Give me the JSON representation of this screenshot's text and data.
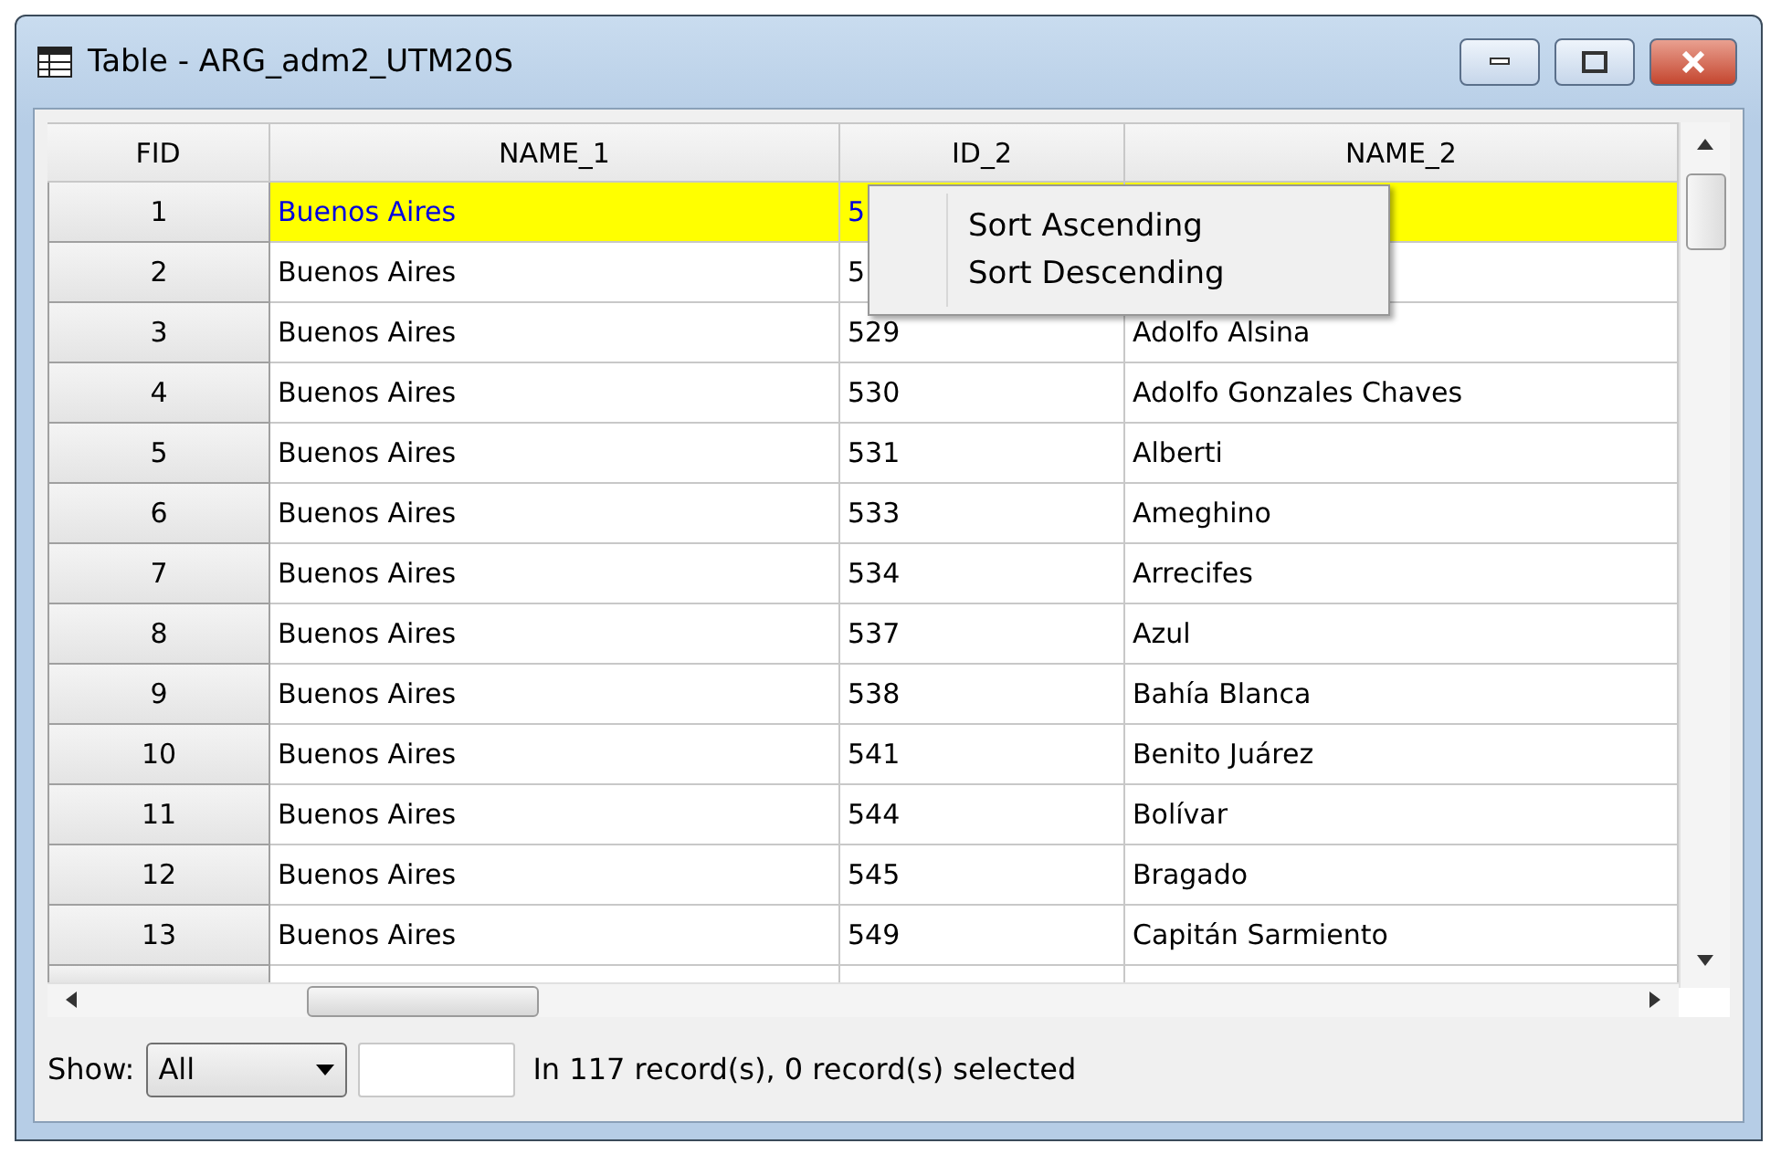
{
  "window": {
    "title": "Table - ARG_adm2_UTM20S"
  },
  "table": {
    "columns": [
      "FID",
      "NAME_1",
      "ID_2",
      "NAME_2"
    ],
    "rows": [
      {
        "fid": "1",
        "name_1": "Buenos Aires",
        "id_2": "5",
        "selected": true
      },
      {
        "fid": "2",
        "name_1": "Buenos Aires",
        "id_2": "5",
        "selected": false
      },
      {
        "fid": "3",
        "name_1": "Buenos Aires",
        "id_2": "529",
        "name_2": "Adolfo Alsina",
        "selected": false
      },
      {
        "fid": "4",
        "name_1": "Buenos Aires",
        "id_2": "530",
        "name_2": "Adolfo Gonzales Chaves",
        "selected": false
      },
      {
        "fid": "5",
        "name_1": "Buenos Aires",
        "id_2": "531",
        "name_2": "Alberti",
        "selected": false
      },
      {
        "fid": "6",
        "name_1": "Buenos Aires",
        "id_2": "533",
        "name_2": "Ameghino",
        "selected": false
      },
      {
        "fid": "7",
        "name_1": "Buenos Aires",
        "id_2": "534",
        "name_2": "Arrecifes",
        "selected": false
      },
      {
        "fid": "8",
        "name_1": "Buenos Aires",
        "id_2": "537",
        "name_2": "Azul",
        "selected": false
      },
      {
        "fid": "9",
        "name_1": "Buenos Aires",
        "id_2": "538",
        "name_2": "Bahía Blanca",
        "selected": false
      },
      {
        "fid": "10",
        "name_1": "Buenos Aires",
        "id_2": "541",
        "name_2": "Benito Juárez",
        "selected": false
      },
      {
        "fid": "11",
        "name_1": "Buenos Aires",
        "id_2": "544",
        "name_2": "Bolívar",
        "selected": false
      },
      {
        "fid": "12",
        "name_1": "Buenos Aires",
        "id_2": "545",
        "name_2": "Bragado",
        "selected": false
      },
      {
        "fid": "13",
        "name_1": "Buenos Aires",
        "id_2": "549",
        "name_2": "Capitán Sarmiento",
        "selected": false
      }
    ]
  },
  "context_menu": {
    "items": [
      "Sort Ascending",
      "Sort Descending"
    ]
  },
  "footer": {
    "show_label": "Show:",
    "show_value": "All",
    "status": "In 117 record(s), 0 record(s) selected"
  }
}
